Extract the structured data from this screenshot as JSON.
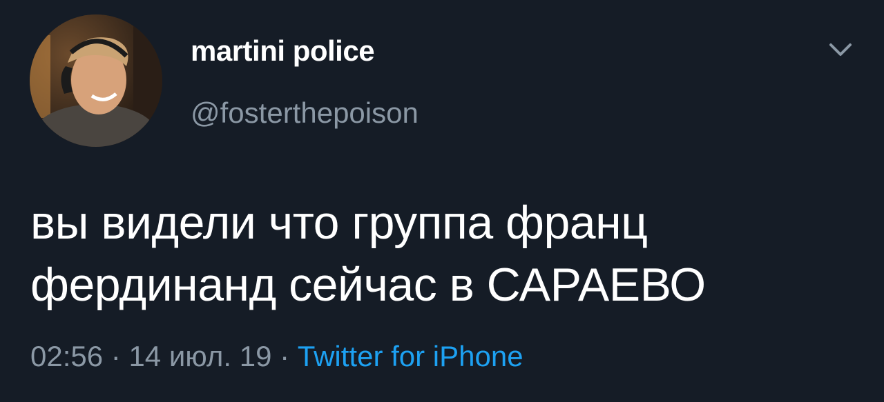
{
  "tweet": {
    "display_name": "martini police",
    "handle": "@fosterthepoison",
    "text": "вы видели что группа франц фердинанд сейчас в САРАЕВО",
    "time": "02:56",
    "separator": " · ",
    "date": "14 июл. 19",
    "source": "Twitter for iPhone",
    "icons": {
      "avatar": "profile-photo",
      "more": "chevron-down-icon"
    }
  },
  "colors": {
    "background": "#151c26",
    "primary_text": "#ffffff",
    "secondary_text": "#8b98a5",
    "link": "#1da1f2"
  }
}
